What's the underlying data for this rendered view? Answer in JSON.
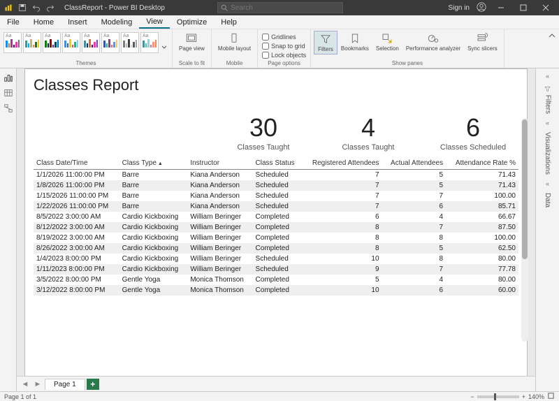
{
  "titlebar": {
    "title": "ClassReport - Power BI Desktop",
    "search_placeholder": "Search",
    "signin": "Sign in"
  },
  "menu": [
    "File",
    "Home",
    "Insert",
    "Modeling",
    "View",
    "Optimize",
    "Help"
  ],
  "menu_active": 4,
  "ribbon": {
    "themes_label": "Themes",
    "page_view": "Page view",
    "scale_label": "Scale to fit",
    "mobile_layout": "Mobile layout",
    "mobile_label": "Mobile",
    "gridlines": "Gridlines",
    "snap": "Snap to grid",
    "lock": "Lock objects",
    "page_options_label": "Page options",
    "filters": "Filters",
    "bookmarks": "Bookmarks",
    "selection": "Selection",
    "perf": "Performance analyzer",
    "sync": "Sync slicers",
    "show_panes_label": "Show panes"
  },
  "right_rail": {
    "filters": "Filters",
    "visualizations": "Visualizations",
    "data": "Data"
  },
  "report": {
    "title": "Classes Report",
    "cards": [
      {
        "value": "30",
        "label": "Classes Taught"
      },
      {
        "value": "4",
        "label": "Classes Taught"
      },
      {
        "value": "6",
        "label": "Classes Scheduled"
      }
    ],
    "columns": [
      "Class Date/Time",
      "Class Type",
      "Instructor",
      "Class Status",
      "Registered Attendees",
      "Actual Attendees",
      "Attendance Rate %"
    ],
    "sort_col": 1,
    "rows": [
      [
        "1/1/2026 11:00:00 PM",
        "Barre",
        "Kiana Anderson",
        "Scheduled",
        "7",
        "5",
        "71.43"
      ],
      [
        "1/8/2026 11:00:00 PM",
        "Barre",
        "Kiana Anderson",
        "Scheduled",
        "7",
        "5",
        "71.43"
      ],
      [
        "1/15/2026 11:00:00 PM",
        "Barre",
        "Kiana Anderson",
        "Scheduled",
        "7",
        "7",
        "100.00"
      ],
      [
        "1/22/2026 11:00:00 PM",
        "Barre",
        "Kiana Anderson",
        "Scheduled",
        "7",
        "6",
        "85.71"
      ],
      [
        "8/5/2022 3:00:00 AM",
        "Cardio Kickboxing",
        "William Beringer",
        "Completed",
        "6",
        "4",
        "66.67"
      ],
      [
        "8/12/2022 3:00:00 AM",
        "Cardio Kickboxing",
        "William Beringer",
        "Completed",
        "8",
        "7",
        "87.50"
      ],
      [
        "8/19/2022 3:00:00 AM",
        "Cardio Kickboxing",
        "William Beringer",
        "Completed",
        "8",
        "8",
        "100.00"
      ],
      [
        "8/26/2022 3:00:00 AM",
        "Cardio Kickboxing",
        "William Beringer",
        "Completed",
        "8",
        "5",
        "62.50"
      ],
      [
        "1/4/2023 8:00:00 PM",
        "Cardio Kickboxing",
        "William Beringer",
        "Scheduled",
        "10",
        "8",
        "80.00"
      ],
      [
        "1/11/2023 8:00:00 PM",
        "Cardio Kickboxing",
        "William Beringer",
        "Scheduled",
        "9",
        "7",
        "77.78"
      ],
      [
        "3/5/2022 8:00:00 PM",
        "Gentle Yoga",
        "Monica Thomson",
        "Completed",
        "5",
        "4",
        "80.00"
      ],
      [
        "3/12/2022 8:00:00 PM",
        "Gentle Yoga",
        "Monica Thomson",
        "Completed",
        "10",
        "6",
        "60.00"
      ]
    ]
  },
  "page_tabs": {
    "page1": "Page 1"
  },
  "status": {
    "page_info": "Page 1 of 1",
    "zoom": "140%"
  },
  "theme_palettes": [
    [
      "#118dff",
      "#e66c37",
      "#a933a2",
      "#6b007b",
      "#e044a7",
      "#747474"
    ],
    [
      "#499195",
      "#00acfc",
      "#c4b07b",
      "#f18f49",
      "#326633",
      "#f1c716"
    ],
    [
      "#107c10",
      "#002050",
      "#a80000",
      "#5c2d91",
      "#004b50",
      "#0078d4"
    ],
    [
      "#4a8ddc",
      "#4c5d8a",
      "#f3c911",
      "#dc5b57",
      "#33ae81",
      "#95c8f0"
    ],
    [
      "#499195",
      "#12239e",
      "#e66c37",
      "#6b007b",
      "#e044a7",
      "#744ec2"
    ],
    [
      "#3257a8",
      "#37a794",
      "#8b3d88",
      "#dd6b7f",
      "#6b91c9",
      "#f5c869"
    ],
    [
      "#7f7f7f",
      "#bfbfbf",
      "#404040",
      "#d9d9d9",
      "#595959",
      "#a6a6a6"
    ],
    [
      "#499195",
      "#4ec5a5",
      "#8ad4eb",
      "#b887ad",
      "#f8977e",
      "#eb895f"
    ]
  ],
  "chart_data": {
    "type": "table",
    "title": "Classes Report",
    "summary_cards": [
      {
        "metric": "Classes Taught",
        "value": 30
      },
      {
        "metric": "Classes Taught",
        "value": 4
      },
      {
        "metric": "Classes Scheduled",
        "value": 6
      }
    ],
    "columns": [
      "Class Date/Time",
      "Class Type",
      "Instructor",
      "Class Status",
      "Registered Attendees",
      "Actual Attendees",
      "Attendance Rate %"
    ],
    "rows": [
      [
        "1/1/2026 11:00:00 PM",
        "Barre",
        "Kiana Anderson",
        "Scheduled",
        7,
        5,
        71.43
      ],
      [
        "1/8/2026 11:00:00 PM",
        "Barre",
        "Kiana Anderson",
        "Scheduled",
        7,
        5,
        71.43
      ],
      [
        "1/15/2026 11:00:00 PM",
        "Barre",
        "Kiana Anderson",
        "Scheduled",
        7,
        7,
        100.0
      ],
      [
        "1/22/2026 11:00:00 PM",
        "Barre",
        "Kiana Anderson",
        "Scheduled",
        7,
        6,
        85.71
      ],
      [
        "8/5/2022 3:00:00 AM",
        "Cardio Kickboxing",
        "William Beringer",
        "Completed",
        6,
        4,
        66.67
      ],
      [
        "8/12/2022 3:00:00 AM",
        "Cardio Kickboxing",
        "William Beringer",
        "Completed",
        8,
        7,
        87.5
      ],
      [
        "8/19/2022 3:00:00 AM",
        "Cardio Kickboxing",
        "William Beringer",
        "Completed",
        8,
        8,
        100.0
      ],
      [
        "8/26/2022 3:00:00 AM",
        "Cardio Kickboxing",
        "William Beringer",
        "Completed",
        8,
        5,
        62.5
      ],
      [
        "1/4/2023 8:00:00 PM",
        "Cardio Kickboxing",
        "William Beringer",
        "Scheduled",
        10,
        8,
        80.0
      ],
      [
        "1/11/2023 8:00:00 PM",
        "Cardio Kickboxing",
        "William Beringer",
        "Scheduled",
        9,
        7,
        77.78
      ],
      [
        "3/5/2022 8:00:00 PM",
        "Gentle Yoga",
        "Monica Thomson",
        "Completed",
        5,
        4,
        80.0
      ],
      [
        "3/12/2022 8:00:00 PM",
        "Gentle Yoga",
        "Monica Thomson",
        "Completed",
        10,
        6,
        60.0
      ]
    ]
  }
}
